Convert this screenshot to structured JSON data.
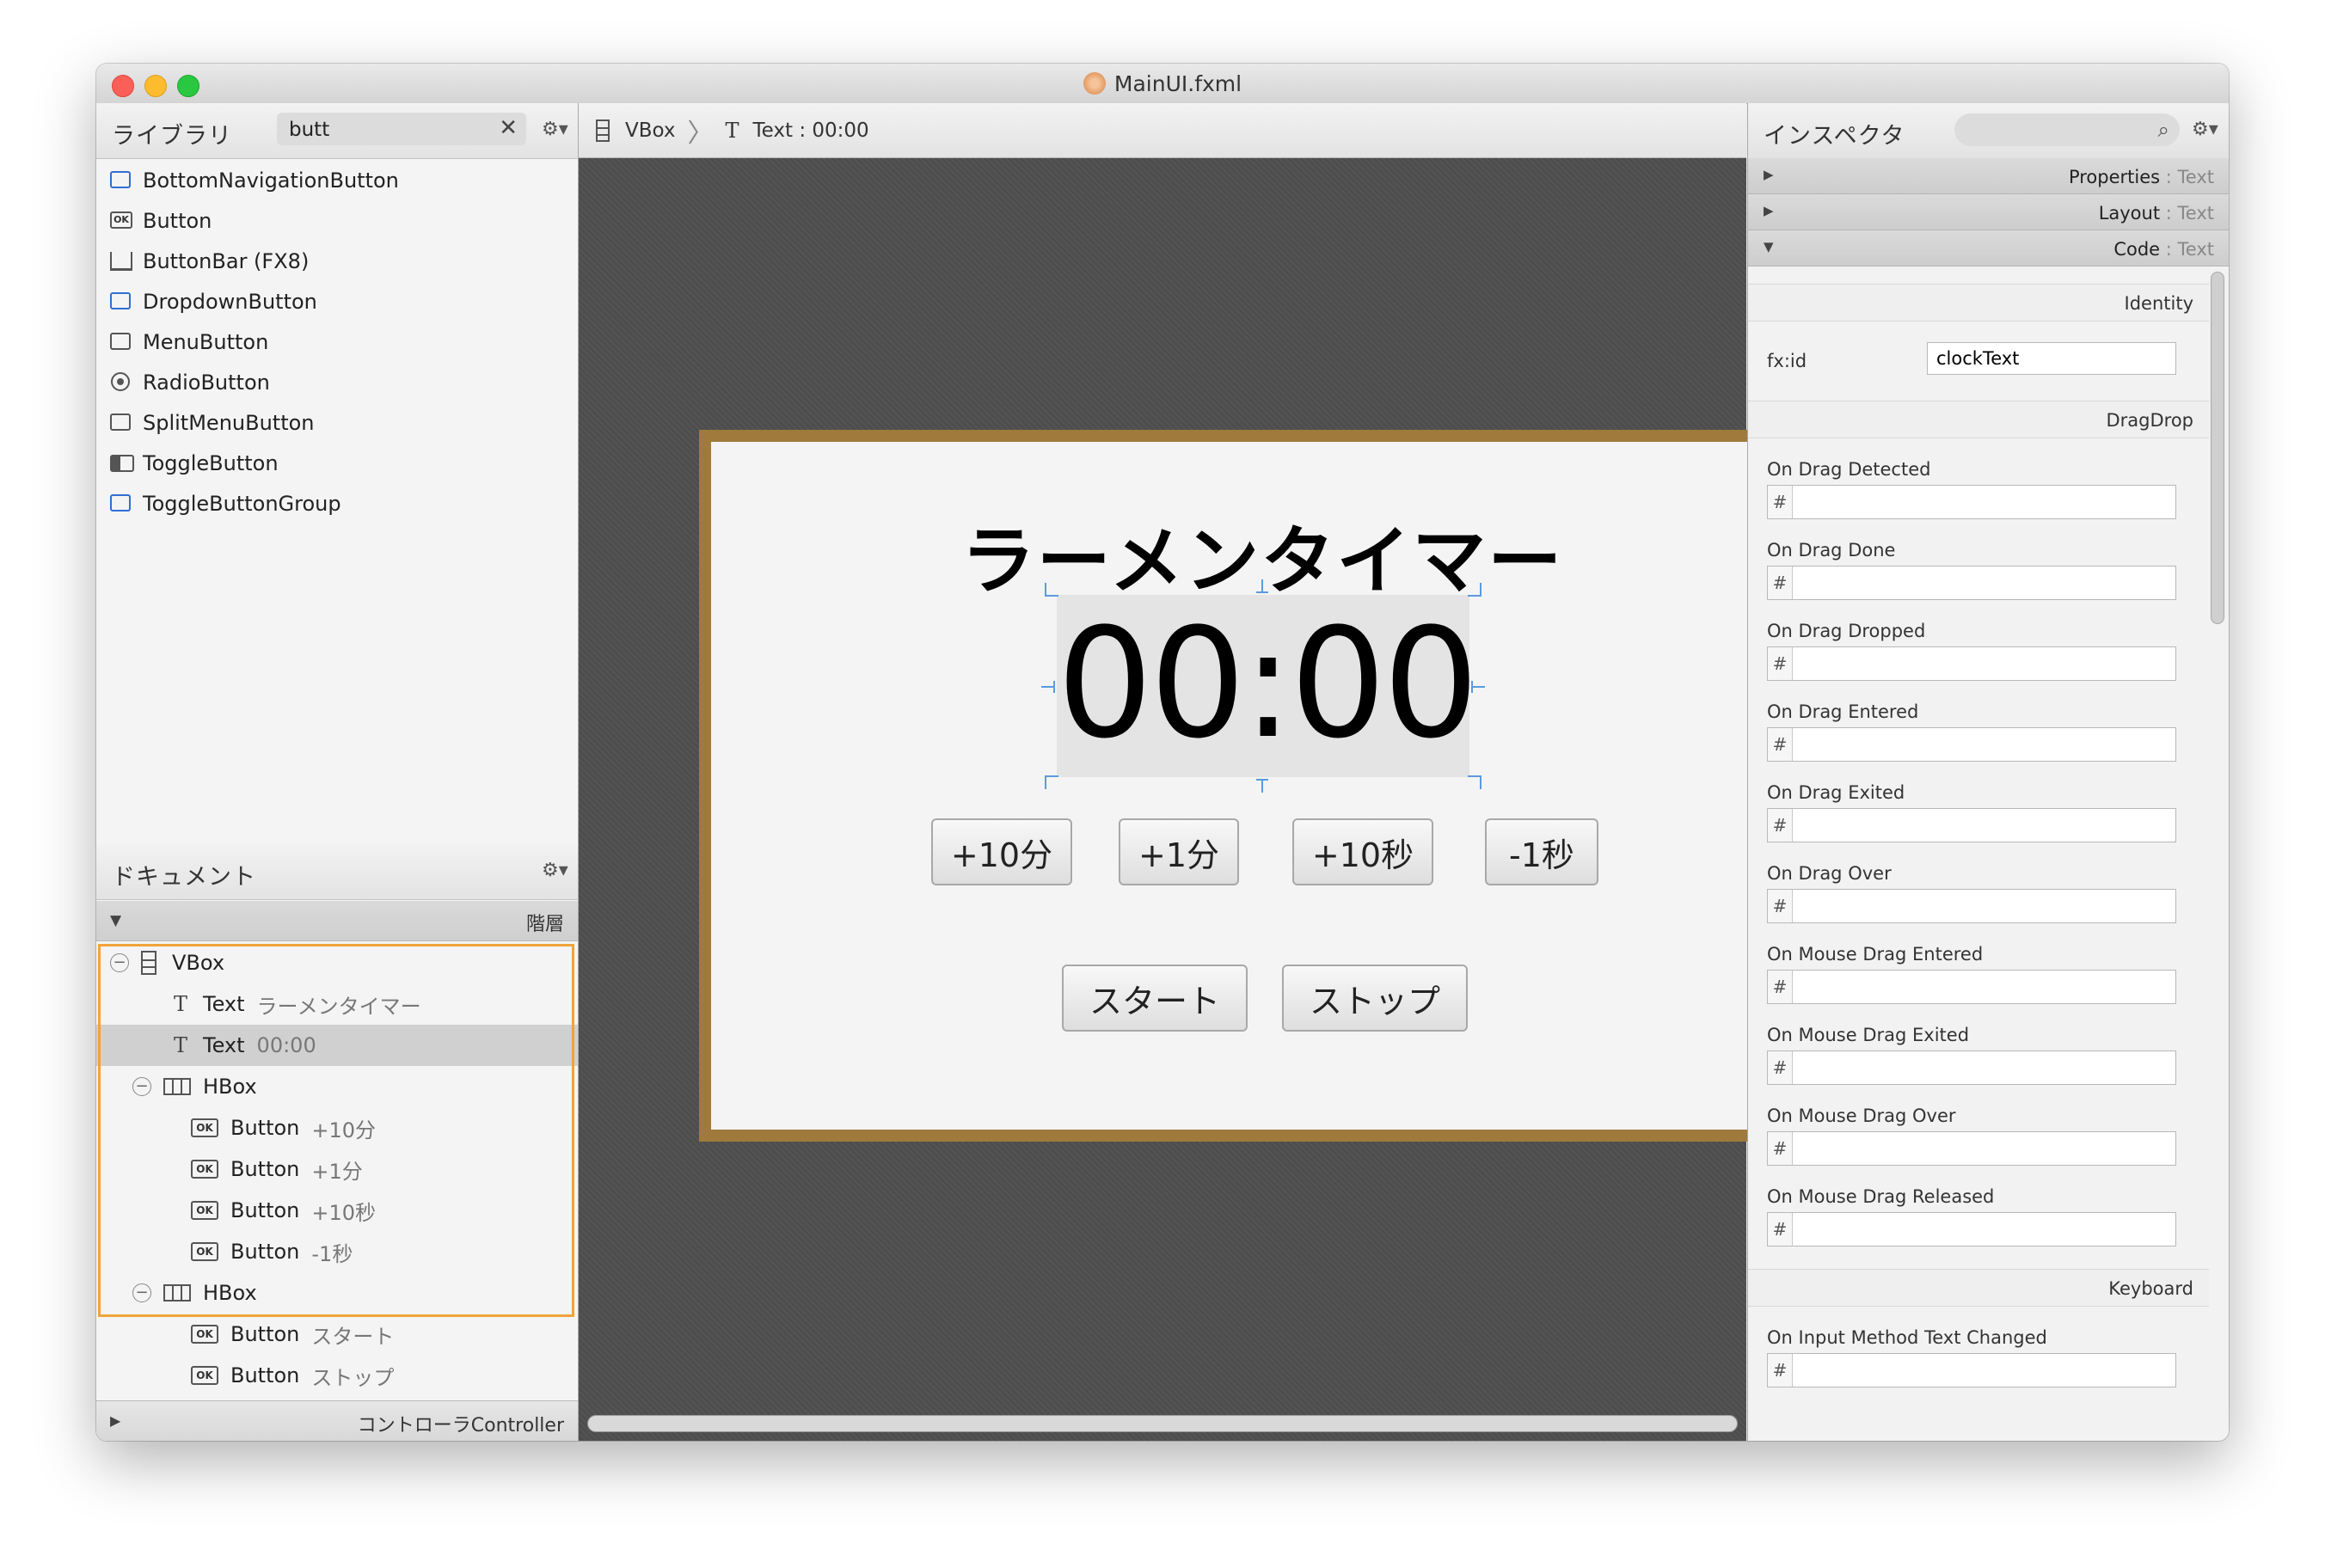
{
  "window": {
    "title": "MainUI.fxml"
  },
  "library": {
    "title": "ライブラリ",
    "search_value": "butt",
    "items": [
      {
        "label": "BottomNavigationButton",
        "icon": "bottom-navigation-button-icon"
      },
      {
        "label": "Button",
        "icon": "ok-button-icon"
      },
      {
        "label": "ButtonBar  (FX8)",
        "icon": "button-bar-icon"
      },
      {
        "label": "DropdownButton",
        "icon": "dropdown-button-icon"
      },
      {
        "label": "MenuButton",
        "icon": "menu-button-icon"
      },
      {
        "label": "RadioButton",
        "icon": "radio-button-icon"
      },
      {
        "label": "SplitMenuButton",
        "icon": "split-menu-button-icon"
      },
      {
        "label": "ToggleButton",
        "icon": "toggle-button-icon"
      },
      {
        "label": "ToggleButtonGroup",
        "icon": "toggle-button-group-icon"
      }
    ]
  },
  "document": {
    "title": "ドキュメント",
    "hierarchy_label": "階層",
    "tree": [
      {
        "type": "VBox",
        "value": ""
      },
      {
        "type": "Text",
        "value": "ラーメンタイマー"
      },
      {
        "type": "Text",
        "value": "00:00"
      },
      {
        "type": "HBox",
        "value": ""
      },
      {
        "type": "Button",
        "value": "+10分"
      },
      {
        "type": "Button",
        "value": "+1分"
      },
      {
        "type": "Button",
        "value": "+10秒"
      },
      {
        "type": "Button",
        "value": "-1秒"
      },
      {
        "type": "HBox",
        "value": ""
      },
      {
        "type": "Button",
        "value": "スタート"
      },
      {
        "type": "Button",
        "value": "ストップ"
      }
    ],
    "controller_label": "コントローラController"
  },
  "breadcrumb": {
    "vbox": "VBox",
    "text": "Text : 00:00"
  },
  "preview": {
    "title": "ラーメンタイマー",
    "clock": "00:00",
    "buttons_row1": [
      "+10分",
      "+1分",
      "+10秒",
      "-1秒"
    ],
    "buttons_row2": [
      "スタート",
      "ストップ"
    ],
    "frame_color": "#a07a3c",
    "selection_color": "#5b9bdf"
  },
  "inspector": {
    "title": "インスペクタ",
    "sections": [
      {
        "name": "Properties",
        "type": "Text"
      },
      {
        "name": "Layout",
        "type": "Text"
      },
      {
        "name": "Code",
        "type": "Text"
      }
    ],
    "identity_label": "Identity",
    "fxid_label": "fx:id",
    "fxid_value": "clockText",
    "dragdrop_label": "DragDrop",
    "drag_events": [
      "On Drag Detected",
      "On Drag Done",
      "On Drag Dropped",
      "On Drag Entered",
      "On Drag Exited",
      "On Drag Over",
      "On Mouse Drag Entered",
      "On Mouse Drag Exited",
      "On Mouse Drag Over",
      "On Mouse Drag Released"
    ],
    "keyboard_label": "Keyboard",
    "keyboard_events": [
      "On Input Method Text Changed"
    ],
    "hash": "#"
  }
}
